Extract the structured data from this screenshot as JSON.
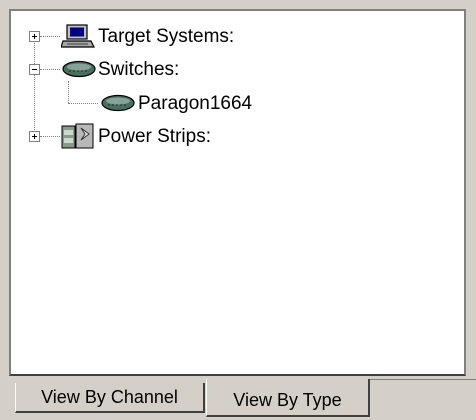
{
  "tree": {
    "items": [
      {
        "label": "Target Systems:",
        "expanded": false,
        "icon": "computer-icon"
      },
      {
        "label": "Switches:",
        "expanded": true,
        "icon": "switch-device-icon",
        "children": [
          {
            "label": "Paragon1664",
            "icon": "switch-device-icon"
          }
        ]
      },
      {
        "label": "Power Strips:",
        "expanded": false,
        "icon": "power-strip-icon"
      }
    ]
  },
  "tabs": [
    {
      "label": "View By Channel",
      "active": false
    },
    {
      "label": "View By Type",
      "active": true
    }
  ],
  "colors": {
    "background": "#d4d0c8",
    "panel": "#ffffff",
    "switch_icon": "#4a6e5e"
  }
}
